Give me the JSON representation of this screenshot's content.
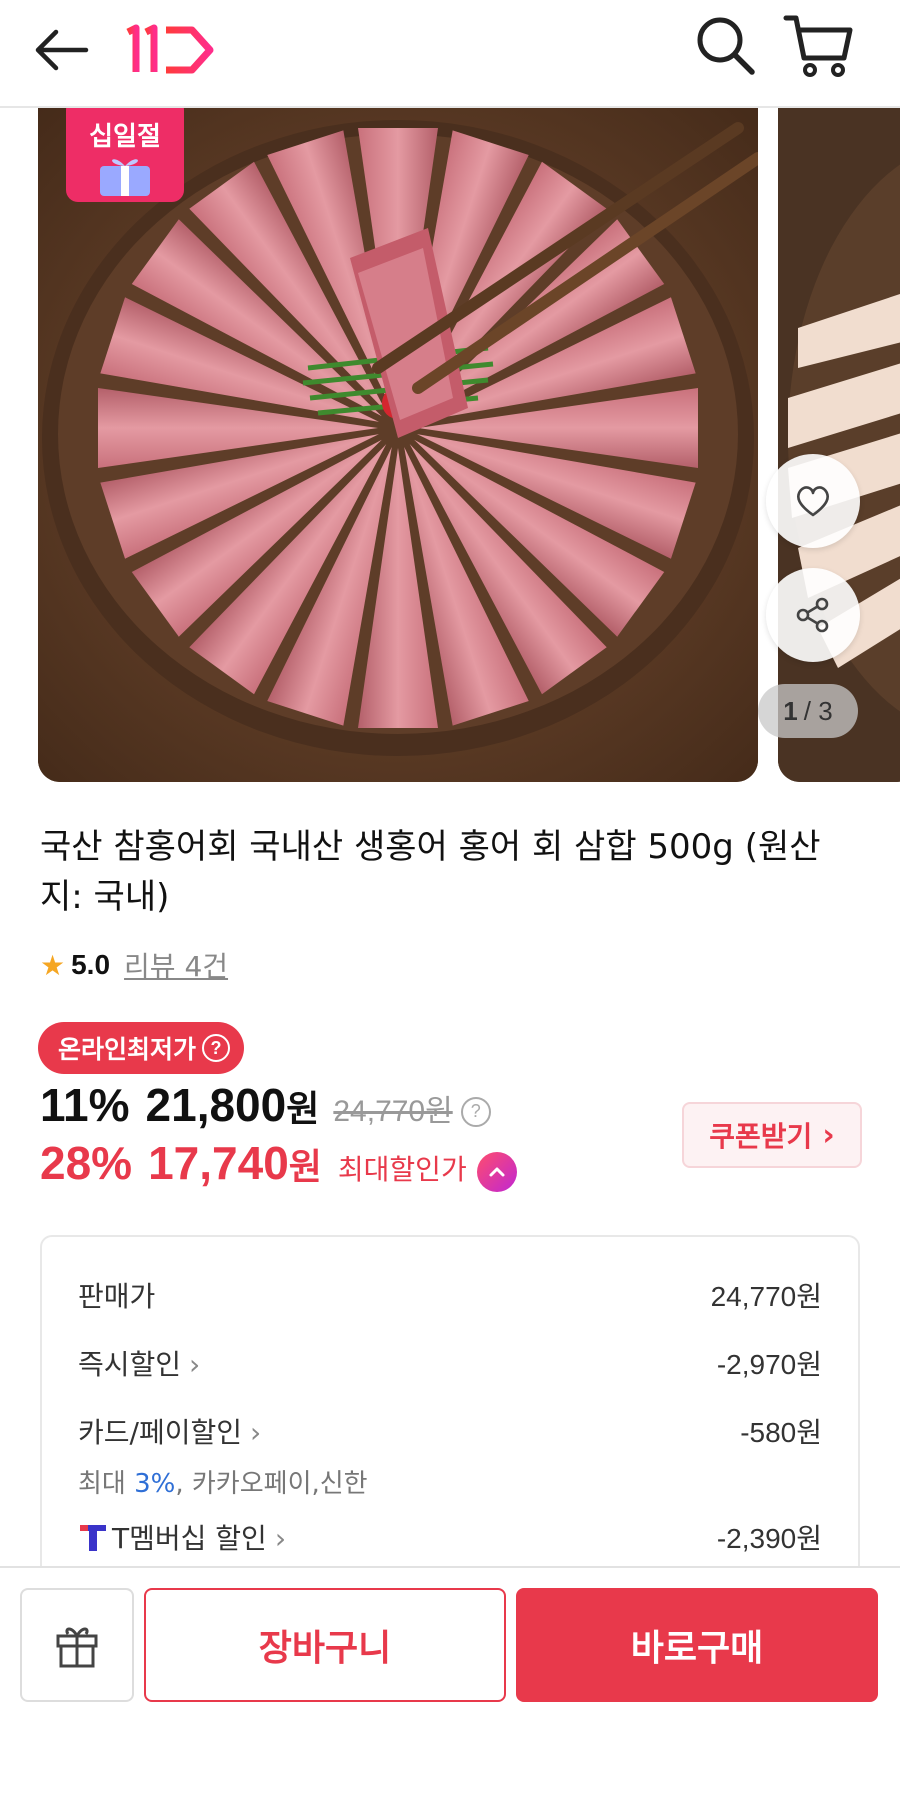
{
  "header": {
    "back_icon": "arrow-left-icon",
    "logo_text": "11",
    "search_icon": "search-icon",
    "cart_icon": "cart-icon"
  },
  "gallery": {
    "festival_badge": "십일절",
    "page_current": "1",
    "page_total": "/ 3",
    "heart_icon": "heart-icon",
    "share_icon": "share-icon"
  },
  "product": {
    "title": "국산 참홍어회 국내산 생홍어 홍어 회 삼합 500g (원산지: 국내)",
    "rating_star": "★",
    "rating_score": "5.0",
    "reviews": "리뷰 4건"
  },
  "price": {
    "lowest_badge": "온라인최저가",
    "lowest_badge_q": "?",
    "rate1": "11%",
    "price1": "21,800",
    "won1": "원",
    "original": "24,770원",
    "original_q": "?",
    "rate2": "28%",
    "price2": "17,740",
    "won2": "원",
    "max_label": "최대할인가",
    "coupon_label": "쿠폰받기",
    "coupon_arrow": "›"
  },
  "breakdown": {
    "sale_label": "판매가",
    "sale_amount": "24,770원",
    "instant_label": "즉시할인",
    "instant_amount": "-2,970원",
    "card_label": "카드/페이할인",
    "card_amount": "-580원",
    "card_note_prefix": "최대 ",
    "card_note_pct": "3%",
    "card_note_suffix": ", 카카오페이,신한",
    "tmember_label": "T멤버십 할인",
    "tmember_amount": "-2,390원",
    "arrow": "›"
  },
  "bottom_bar": {
    "gift_icon": "gift-icon",
    "cart_label": "장바구니",
    "buy_label": "바로구매"
  },
  "colors": {
    "accent": "#e8394b",
    "link_blue": "#2f6fd6",
    "star": "#f5a623"
  }
}
